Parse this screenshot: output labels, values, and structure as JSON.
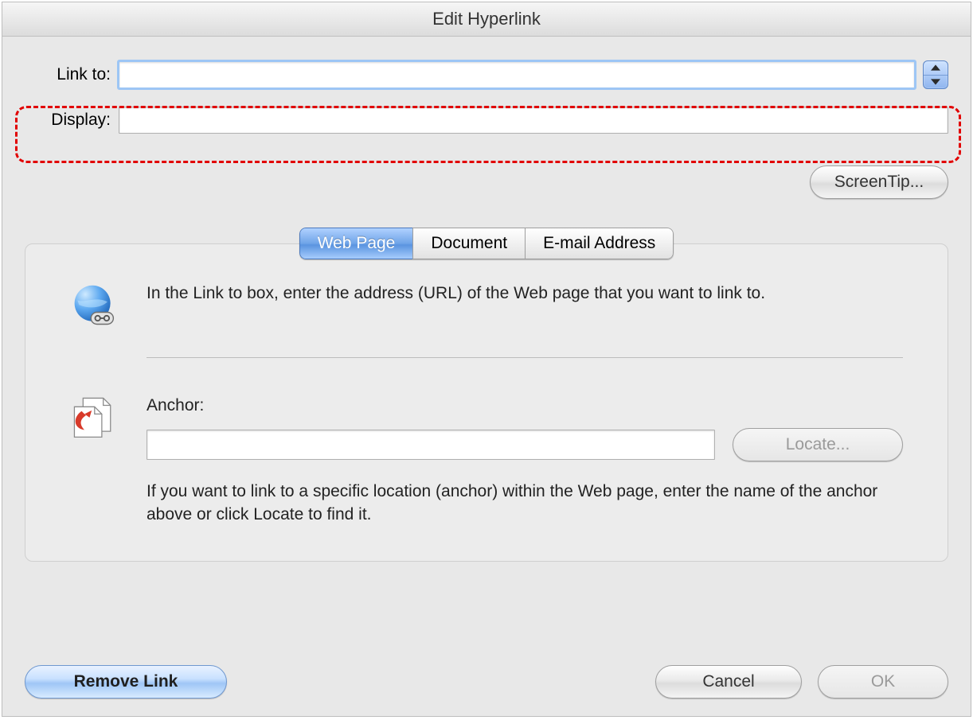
{
  "title": "Edit Hyperlink",
  "form": {
    "linkto_label": "Link to:",
    "linkto_value": "",
    "display_label": "Display:",
    "display_value": ""
  },
  "buttons": {
    "screentip": "ScreenTip...",
    "locate": "Locate...",
    "remove_link": "Remove Link",
    "cancel": "Cancel",
    "ok": "OK"
  },
  "tabs": {
    "webpage": "Web Page",
    "document": "Document",
    "email": "E-mail Address"
  },
  "panel": {
    "url_desc": "In the Link to box, enter the address (URL) of the Web page that you want to link to.",
    "anchor_label": "Anchor:",
    "anchor_value": "",
    "anchor_desc": "If you want to link to a specific location (anchor) within the Web page, enter the name of the anchor above or click Locate to find it."
  }
}
